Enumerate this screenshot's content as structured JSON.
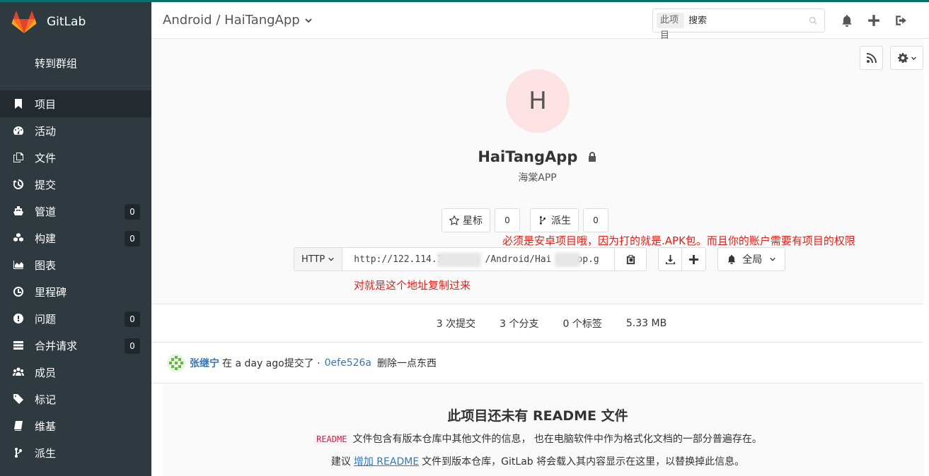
{
  "sidebar": {
    "brand": "GitLab",
    "group_link": "转到群组",
    "items": [
      {
        "label": "项目",
        "badge": null,
        "active": true
      },
      {
        "label": "活动",
        "badge": null
      },
      {
        "label": "文件",
        "badge": null
      },
      {
        "label": "提交",
        "badge": null
      },
      {
        "label": "管道",
        "badge": "0"
      },
      {
        "label": "构建",
        "badge": "0"
      },
      {
        "label": "图表",
        "badge": null
      },
      {
        "label": "里程碑",
        "badge": null
      },
      {
        "label": "问题",
        "badge": "0"
      },
      {
        "label": "合并请求",
        "badge": "0"
      },
      {
        "label": "成员",
        "badge": null
      },
      {
        "label": "标记",
        "badge": null
      },
      {
        "label": "维基",
        "badge": null
      },
      {
        "label": "派生",
        "badge": null
      }
    ]
  },
  "header": {
    "breadcrumb": "Android / HaiTangApp",
    "search_scope": "此项目",
    "search_placeholder": "搜索"
  },
  "project": {
    "avatar_letter": "H",
    "name": "HaiTangApp",
    "description": "海棠APP",
    "star_label": "星标",
    "star_count": "0",
    "fork_label": "派生",
    "fork_count": "0"
  },
  "annotations": {
    "note1": "必须是安卓项目哦，因为打的就是.APK包。而且你的账户需要有项目的权限",
    "note2": "对就是这个地址复制过来"
  },
  "clone": {
    "protocol": "HTTP",
    "url_start": "http://122.114.1",
    "url_mid": "/Android/Hai",
    "url_end": "op.g",
    "notification_label": "全局"
  },
  "stats": {
    "commits": "3 次提交",
    "branches": "3 个分支",
    "tags": "0 个标签",
    "size": "5.33 MB"
  },
  "last_commit": {
    "author": "张继宁",
    "text": "在 a day ago提交了 ·",
    "sha": "0efe526a",
    "message": "删除一点东西"
  },
  "readme": {
    "title": "此项目还未有 README 文件",
    "code": "README",
    "line1": "文件包含有版本仓库中其他文件的信息， 也在电脑软件中作为格式化文档的一部分普遍存在。",
    "line2_prefix": "建议",
    "line2_link": "增加 README",
    "line2_suffix": "文件到版本仓库，GitLab 将会载入其内容显示在这里，以替换掉此信息。"
  },
  "colors": {
    "sidebar_bg": "#2f3940",
    "accent_top": "#0b6e6a",
    "link": "#3777b0",
    "annotation": "#e0211a",
    "avatar_bg": "#fde2e4"
  }
}
